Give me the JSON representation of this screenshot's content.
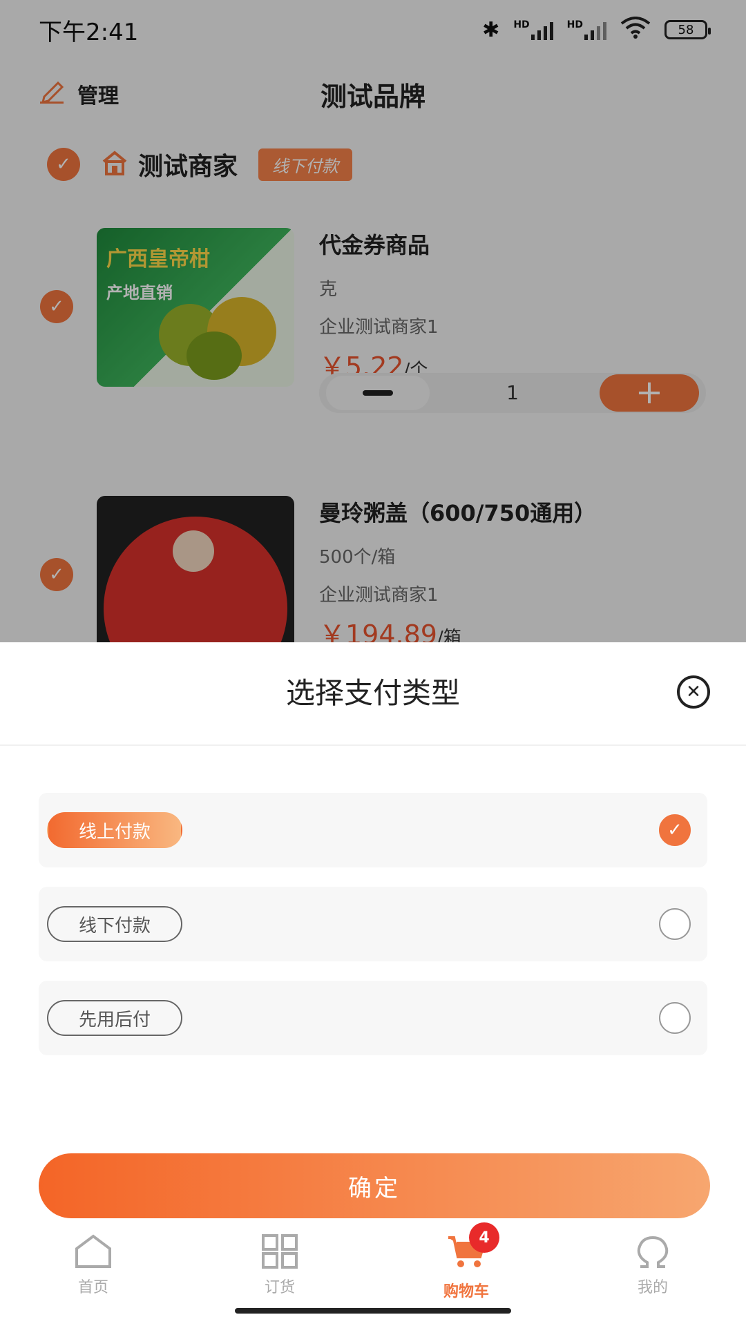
{
  "status_bar": {
    "time": "下午2:41",
    "network_label": "HD",
    "battery": "58"
  },
  "header": {
    "manage_label": "管理",
    "title": "测试品牌"
  },
  "shop": {
    "name": "测试商家",
    "tag": "线下付款"
  },
  "products": [
    {
      "name": "代金券商品",
      "spec": "克",
      "seller": "企业测试商家1",
      "price": "￥5.22",
      "unit": "/个",
      "quantity": "1",
      "image_text": [
        "广西皇帝柑",
        "产地直销"
      ]
    },
    {
      "name": "曼玲粥盖（600/750通用）",
      "spec": "500个/箱",
      "seller": "企业测试商家1",
      "price": "￥194.89",
      "unit": "/箱"
    }
  ],
  "sheet": {
    "title": "选择支付类型",
    "options": [
      {
        "label": "线上付款",
        "selected": true
      },
      {
        "label": "线下付款",
        "selected": false
      },
      {
        "label": "先用后付",
        "selected": false
      }
    ],
    "confirm_label": "确定"
  },
  "tabbar": {
    "items": [
      {
        "label": "首页",
        "icon": "home-icon"
      },
      {
        "label": "订货",
        "icon": "grid-icon"
      },
      {
        "label": "购物车",
        "icon": "cart-icon",
        "badge": "4",
        "active": true
      },
      {
        "label": "我的",
        "icon": "omega-icon"
      }
    ]
  },
  "colors": {
    "accent": "#f0743e",
    "price": "#e8532e",
    "badge": "#e82a2a"
  }
}
